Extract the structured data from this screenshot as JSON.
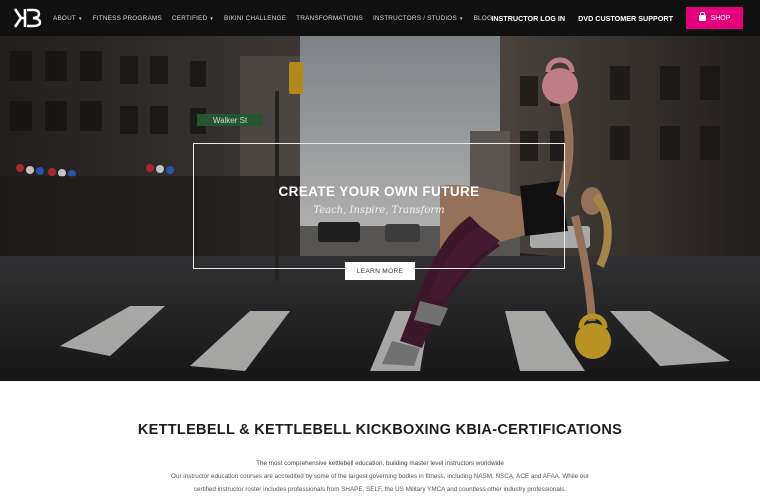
{
  "nav": {
    "logo_text": "KB",
    "links": [
      {
        "label": "About",
        "has_dropdown": true
      },
      {
        "label": "Fitness Programs",
        "has_dropdown": false
      },
      {
        "label": "Certified",
        "has_dropdown": true
      },
      {
        "label": "Bikini Challenge",
        "has_dropdown": false
      },
      {
        "label": "Transformations",
        "has_dropdown": false
      },
      {
        "label": "Instructors / Studios",
        "has_dropdown": true
      },
      {
        "label": "Blog",
        "has_dropdown": false
      }
    ],
    "instructor_login": "Instructor Log In",
    "dvd_support": "DVD Customer Support",
    "shop_label": "Shop",
    "shop_color": "#e4007c"
  },
  "hero": {
    "title": "Create Your Own Future",
    "subtitle": "Teach, Inspire, Transform",
    "button_label": "Learn More",
    "street_sign": "Walker St"
  },
  "section": {
    "title": "Kettlebell & Kettlebell Kickboxing KBIA-Certifications",
    "lead": "The most comprehensive kettlebell education, building master level instructors worldwide",
    "body_line1": "Our instructor education courses are accredited by some of the largest governing bodies in fitness, including NASM, NSCA, ACE and AFAA. While our",
    "body_line2": "certified instructor roster includes professionals from SHAPE, SELF, the US Military YMCA and countless other industry professionals."
  }
}
